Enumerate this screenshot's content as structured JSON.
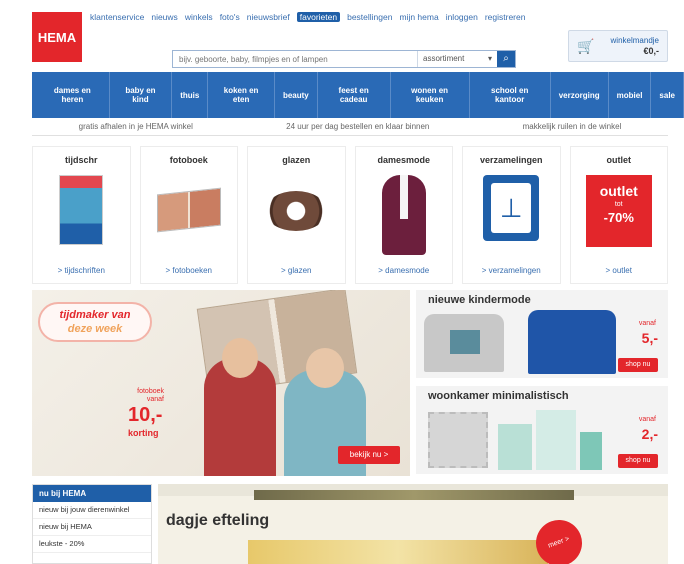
{
  "logo": "HEMA",
  "toplinks": [
    "klantenservice",
    "nieuws",
    "winkels",
    "foto's",
    "nieuwsbrief",
    "favorieten",
    "bestellingen",
    "mijn hema",
    "inloggen",
    "registreren"
  ],
  "search": {
    "placeholder": "bijv. geboorte, baby, filmpjes en of lampen",
    "select": "assortiment",
    "go_icon": "search-icon"
  },
  "cart": {
    "label": "winkelmandje",
    "amount": "€0,-"
  },
  "nav": [
    "dames en heren",
    "baby en kind",
    "thuis",
    "koken en eten",
    "beauty",
    "feest en cadeau",
    "wonen en keuken",
    "school en kantoor",
    "verzorging",
    "mobiel",
    "sale"
  ],
  "usp": [
    "gratis afhalen in je HEMA winkel",
    "24 uur per dag bestellen en klaar binnen",
    "makkelijk ruilen in de winkel"
  ],
  "cards": [
    {
      "title": "tijdschr",
      "link": "> tijdschriften"
    },
    {
      "title": "fotoboek",
      "link": "> fotoboeken"
    },
    {
      "title": "glazen",
      "link": "> glazen"
    },
    {
      "title": "damesmode",
      "link": "> damesmode"
    },
    {
      "title": "verzamelingen",
      "link": "> verzamelingen"
    },
    {
      "title": "outlet",
      "link": "> outlet",
      "outlet_text": "outlet",
      "outlet_sub": "tot",
      "outlet_pct": "-70%"
    }
  ],
  "hero": {
    "badge_line1": "tijdmaker van",
    "badge_line2": "deze week",
    "price_label": "fotoboek vanaf",
    "price": "10,-",
    "price_sub": "korting",
    "button": "bekijk nu >"
  },
  "promo1": {
    "title": "nieuwe kindermode",
    "tag": "vanaf",
    "price": "5,-",
    "button": "shop nu"
  },
  "promo2": {
    "title": "woonkamer minimalistisch",
    "tag": "vanaf",
    "price": "2,-",
    "button": "shop nu"
  },
  "sidebox": {
    "head": "nu bij HEMA",
    "items": [
      "nieuw bij jouw dierenwinkel",
      "nieuw bij HEMA",
      "leukste - 20%"
    ]
  },
  "effeling": {
    "title": "dagje efteling",
    "circle": "meer >"
  }
}
